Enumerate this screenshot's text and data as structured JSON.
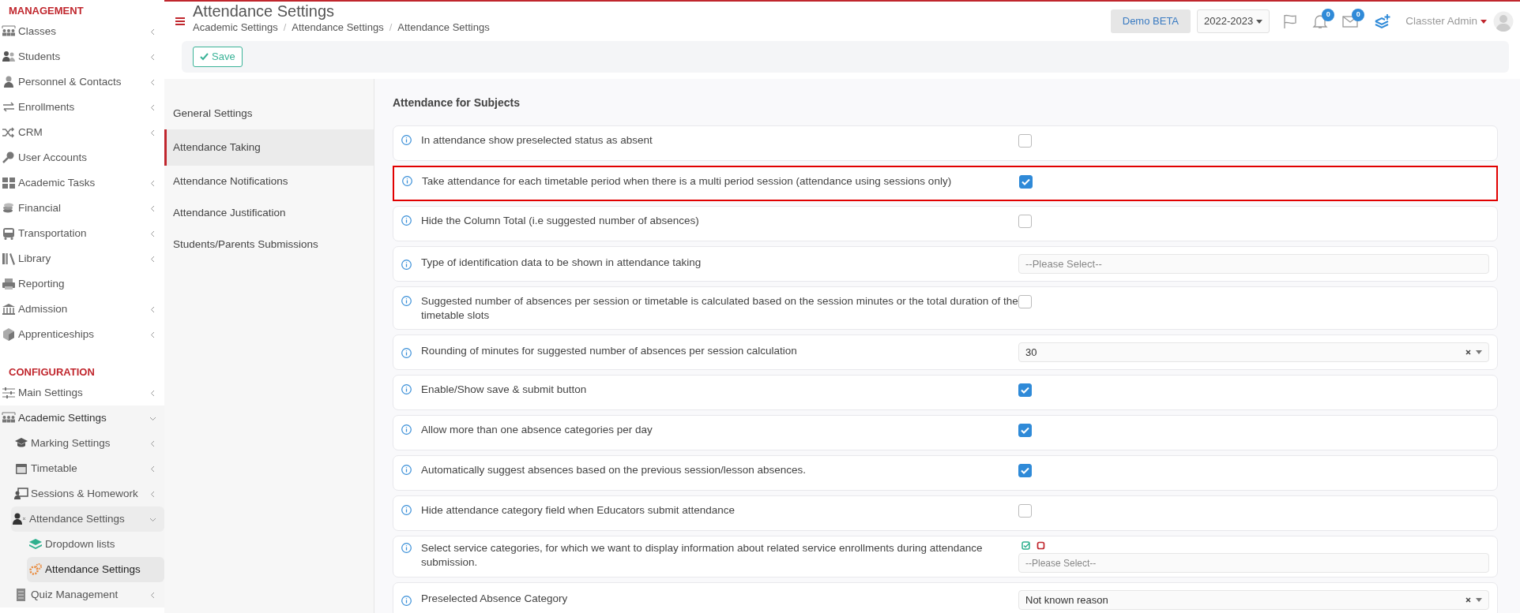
{
  "sidebar": {
    "sections": [
      {
        "title": "MANAGEMENT",
        "items": [
          {
            "label": "Classes",
            "collapsible": true,
            "expanded": false,
            "selected": false
          },
          {
            "label": "Students",
            "collapsible": true,
            "expanded": false,
            "selected": false
          },
          {
            "label": "Personnel & Contacts",
            "collapsible": true,
            "expanded": false,
            "selected": false
          },
          {
            "label": "Enrollments",
            "collapsible": true,
            "expanded": false,
            "selected": false
          },
          {
            "label": "CRM",
            "collapsible": true,
            "expanded": false,
            "selected": false
          },
          {
            "label": "User Accounts",
            "collapsible": false,
            "expanded": false,
            "selected": false
          },
          {
            "label": "Academic Tasks",
            "collapsible": true,
            "expanded": false,
            "selected": false
          },
          {
            "label": "Financial",
            "collapsible": true,
            "expanded": false,
            "selected": false
          },
          {
            "label": "Transportation",
            "collapsible": true,
            "expanded": false,
            "selected": false
          },
          {
            "label": "Library",
            "collapsible": true,
            "expanded": false,
            "selected": false
          },
          {
            "label": "Reporting",
            "collapsible": false,
            "expanded": false,
            "selected": false
          },
          {
            "label": "Admission",
            "collapsible": true,
            "expanded": false,
            "selected": false
          },
          {
            "label": "Apprenticeships",
            "collapsible": true,
            "expanded": false,
            "selected": false
          }
        ]
      },
      {
        "title": "CONFIGURATION",
        "items": [
          {
            "label": "Main Settings",
            "collapsible": true,
            "expanded": false,
            "selected": false
          },
          {
            "label": "Academic Settings",
            "collapsible": true,
            "expanded": true,
            "selected": false,
            "children": [
              {
                "label": "Marking Settings",
                "collapsible": true,
                "expanded": false,
                "selected": false
              },
              {
                "label": "Timetable",
                "collapsible": true,
                "expanded": false,
                "selected": false
              },
              {
                "label": "Sessions & Homework",
                "collapsible": true,
                "expanded": false,
                "selected": false
              },
              {
                "label": "Attendance Settings",
                "collapsible": true,
                "expanded": true,
                "selected": false,
                "children": [
                  {
                    "label": "Dropdown lists",
                    "collapsible": false,
                    "expanded": false,
                    "selected": false
                  },
                  {
                    "label": "Attendance Settings",
                    "collapsible": false,
                    "expanded": false,
                    "selected": true
                  }
                ]
              },
              {
                "label": "Quiz Management",
                "collapsible": true,
                "expanded": false,
                "selected": false
              }
            ]
          }
        ]
      }
    ]
  },
  "header": {
    "title": "Attendance Settings",
    "breadcrumb": [
      "Academic Settings",
      "Attendance Settings",
      "Attendance Settings"
    ],
    "breadcrumb_separator": "/",
    "demo_button": "Demo BETA",
    "year": "2022-2023",
    "notifications_count": "0",
    "messages_count": "0",
    "user": "Classter Admin"
  },
  "toolbar": {
    "save_button": "Save"
  },
  "submenu": [
    {
      "label": "General Settings",
      "selected": false
    },
    {
      "label": "Attendance Taking",
      "selected": true
    },
    {
      "label": "Attendance Notifications",
      "selected": false
    },
    {
      "label": "Attendance Justification",
      "selected": false
    },
    {
      "label": "Students/Parents Submissions",
      "selected": false
    }
  ],
  "section_title": "Attendance for Subjects",
  "settings": [
    {
      "label": "In attendance show preselected status as absent",
      "kind": "checkbox",
      "checked": false,
      "highlighted": false
    },
    {
      "label": "Take attendance for each timetable period when there is a multi period session (attendance using sessions only)",
      "kind": "checkbox",
      "checked": true,
      "highlighted": true
    },
    {
      "label": "Hide the Column Total (i.e suggested number of absences)",
      "kind": "checkbox",
      "checked": false,
      "highlighted": false
    },
    {
      "label": "Type of identification data to be shown in attendance taking",
      "kind": "select",
      "placeholder": "--Please Select--",
      "highlighted": false
    },
    {
      "label": "Suggested number of absences per session or timetable is calculated based on the session minutes or the total duration of the timetable slots",
      "kind": "checkbox",
      "checked": false,
      "highlighted": false
    },
    {
      "label": "Rounding of minutes for suggested number of absences per session calculation",
      "kind": "select",
      "value": "30",
      "highlighted": false
    },
    {
      "label": "Enable/Show save & submit button",
      "kind": "checkbox",
      "checked": true,
      "highlighted": false
    },
    {
      "label": "Allow more than one absence categories per day",
      "kind": "checkbox",
      "checked": true,
      "highlighted": false
    },
    {
      "label": "Automatically suggest absences based on the previous session/lesson absences.",
      "kind": "checkbox",
      "checked": true,
      "highlighted": false
    },
    {
      "label": "Hide attendance category field when Educators submit attendance",
      "kind": "checkbox",
      "checked": false,
      "highlighted": false
    },
    {
      "label": "Select service categories, for which we want to display information about related service enrollments during attendance submission.",
      "kind": "multiselect",
      "placeholder": "--Please Select--",
      "highlighted": false
    },
    {
      "label": "Preselected Absence Category",
      "kind": "select",
      "value": "Not known reason",
      "highlighted": false
    }
  ]
}
